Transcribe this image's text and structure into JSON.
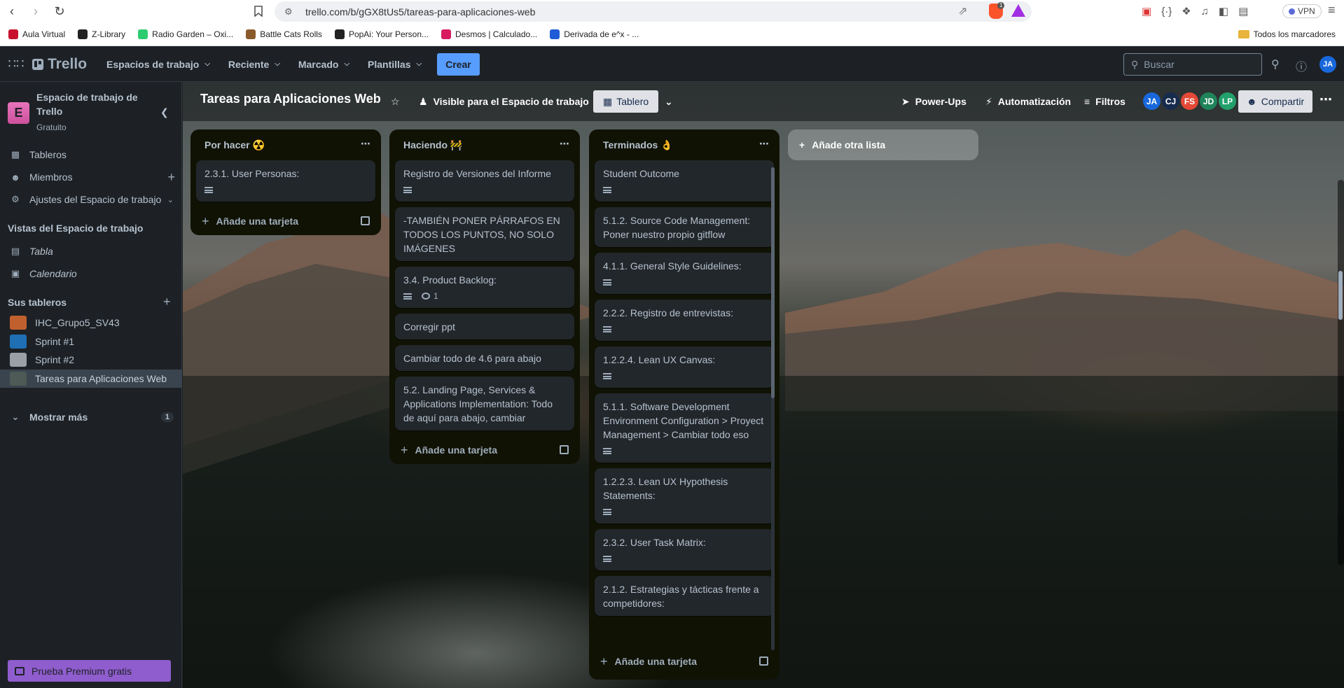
{
  "browser": {
    "url": "trello.com/b/gGX8tUs5/tareas-para-aplicaciones-web",
    "brave_badge": "1",
    "vpn_label": "VPN",
    "bookmarks": [
      {
        "label": "Aula Virtual",
        "color": "#c8102e"
      },
      {
        "label": "Z-Library",
        "color": "#222222"
      },
      {
        "label": "Radio Garden – Oxi...",
        "color": "#2ecc71"
      },
      {
        "label": "Battle Cats Rolls",
        "color": "#8b5a2b"
      },
      {
        "label": "PopAi: Your Person...",
        "color": "#222222"
      },
      {
        "label": "Desmos | Calculado...",
        "color": "#d81b60"
      },
      {
        "label": "Derivada de e^x - ...",
        "color": "#1f5bd6"
      }
    ],
    "all_bookmarks": "Todos los marcadores"
  },
  "header": {
    "logo": "Trello",
    "menu": [
      "Espacios de trabajo",
      "Reciente",
      "Marcado",
      "Plantillas"
    ],
    "create": "Crear",
    "search_placeholder": "Buscar",
    "avatar": "JA"
  },
  "sidebar": {
    "workspace_initial": "E",
    "workspace_name": "Espacio de trabajo de Trello",
    "workspace_plan": "Gratuito",
    "items": [
      {
        "label": "Tableros"
      },
      {
        "label": "Miembros"
      },
      {
        "label": "Ajustes del Espacio de trabajo"
      }
    ],
    "views_title": "Vistas del Espacio de trabajo",
    "views": [
      "Tabla",
      "Calendario"
    ],
    "boards_title": "Sus tableros",
    "boards": [
      {
        "label": "IHC_Grupo5_SV43",
        "color": "#c0602f"
      },
      {
        "label": "Sprint #1",
        "color": "#1f6fb5"
      },
      {
        "label": "Sprint #2",
        "color": "#9aa0a6"
      },
      {
        "label": "Tareas para Aplicaciones Web",
        "color": "#4d5a55"
      }
    ],
    "show_more": "Mostrar más",
    "show_more_count": "1",
    "premium": "Prueba Premium gratis"
  },
  "board": {
    "title": "Tareas para Aplicaciones Web",
    "visibility": "Visible para el Espacio de trabajo",
    "view": "Tablero",
    "power_ups": "Power-Ups",
    "automation": "Automatización",
    "filters": "Filtros",
    "members": [
      {
        "initials": "JA",
        "color": "#1868db"
      },
      {
        "initials": "CJ",
        "color": "#172b4d"
      },
      {
        "initials": "FS",
        "color": "#e34935"
      },
      {
        "initials": "JD",
        "color": "#1f845a"
      },
      {
        "initials": "LP",
        "color": "#22a06b"
      }
    ],
    "share": "Compartir",
    "add_list": "Añade otra lista",
    "add_card": "Añade una tarjeta",
    "lists": [
      {
        "title": "Por hacer ☢️",
        "cards": [
          {
            "title": "2.3.1. User Personas:",
            "desc": true
          }
        ]
      },
      {
        "title": "Haciendo 🚧",
        "cards": [
          {
            "title": "Registro de Versiones del Informe",
            "desc": true
          },
          {
            "title": "-TAMBIÉN PONER PÁRRAFOS EN TODOS LOS PUNTOS, NO SOLO IMÁGENES",
            "desc": false
          },
          {
            "title": "3.4. Product Backlog:",
            "desc": true,
            "comments": "1"
          },
          {
            "title": "Corregir ppt",
            "desc": false
          },
          {
            "title": "Cambiar todo de 4.6 para abajo",
            "desc": false
          },
          {
            "title": "5.2. Landing Page, Services & Applications Implementation: Todo de aquí para abajo, cambiar",
            "desc": false
          }
        ]
      },
      {
        "title": "Terminados 👌",
        "cards": [
          {
            "title": "Student Outcome",
            "desc": true
          },
          {
            "title": "5.1.2. Source Code Management: Poner nuestro propio gitflow",
            "desc": false
          },
          {
            "title": "4.1.1. General Style Guidelines:",
            "desc": true
          },
          {
            "title": "2.2.2. Registro de entrevistas:",
            "desc": true
          },
          {
            "title": "1.2.2.4. Lean UX Canvas:",
            "desc": true
          },
          {
            "title": "5.1.1. Software Development Environment Configuration > Proyect Management > Cambiar todo eso",
            "desc": true
          },
          {
            "title": "1.2.2.3. Lean UX Hypothesis Statements:",
            "desc": true
          },
          {
            "title": "2.3.2. User Task Matrix:",
            "desc": true
          },
          {
            "title": "2.1.2. Estrategias y tácticas frente a competidores:",
            "desc": false
          }
        ]
      }
    ]
  }
}
